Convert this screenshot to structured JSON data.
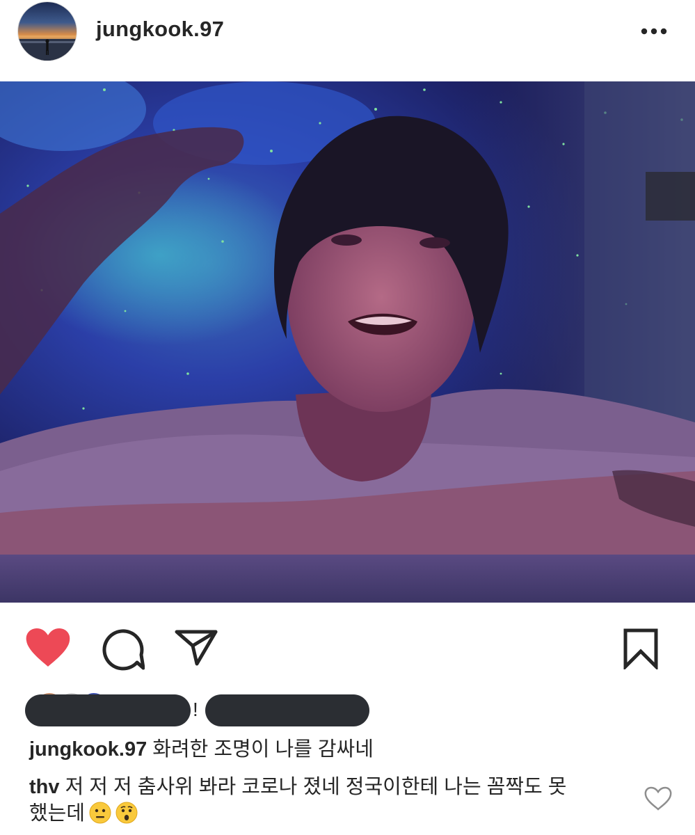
{
  "post": {
    "username": "jungkook.97",
    "more_icon": "more-horizontal-icon"
  },
  "media": {
    "type": "video",
    "sound_icon": "speaker-volume-icon"
  },
  "actions": {
    "like_icon": "heart-filled-icon",
    "comment_icon": "comment-bubble-icon",
    "share_icon": "paper-plane-icon",
    "save_icon": "bookmark-icon",
    "like_color": "#ed4956"
  },
  "likes": {
    "separator": "!"
  },
  "caption": {
    "username": "jungkook.97",
    "text": "화려한 조명이 나를 감싸네"
  },
  "comments": [
    {
      "username": "thv",
      "text": "저 저 저 춤사위 봐라 코로나 졌네 정국이한테 나는 꼼짝도 못",
      "text_line2": "했는데",
      "emojis": [
        "neutral-face-emoji",
        "hushed-face-emoji"
      ],
      "like_icon": "heart-outline-icon"
    }
  ]
}
